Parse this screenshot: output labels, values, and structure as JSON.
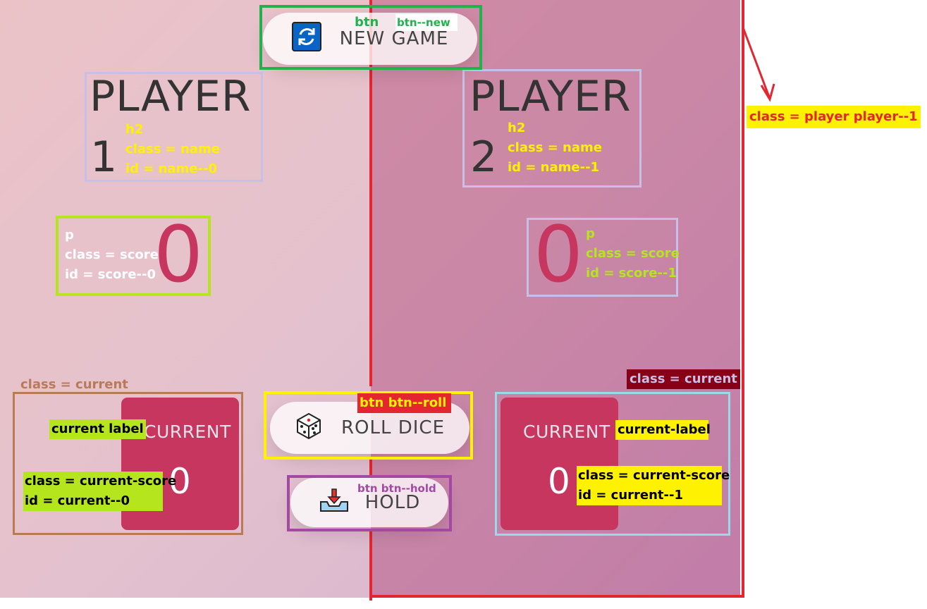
{
  "buttons": {
    "new_game": "NEW GAME",
    "roll_dice": "ROLL DICE",
    "hold": "HOLD"
  },
  "players": [
    {
      "name": "PLAYER",
      "number": "1",
      "score": "0",
      "current_label": "CURRENT",
      "current_score": "0"
    },
    {
      "name": "PLAYER",
      "number": "2",
      "score": "0",
      "current_label": "CURRENT",
      "current_score": "0"
    }
  ],
  "annotations": {
    "btn": "btn",
    "btn_new": "btn--new",
    "btn_roll": "btn   btn--roll",
    "btn_hold": "btn btn--hold",
    "player1_class": "class = player player--1",
    "name0": {
      "tag": "h2",
      "cls": "class = name",
      "id": "id = name--0"
    },
    "name1": {
      "tag": "h2",
      "cls": "class = name",
      "id": "id = name--1"
    },
    "score0": {
      "tag": "p",
      "cls": "class = score",
      "id": "id = score--0"
    },
    "score1": {
      "tag": "p",
      "cls": "class = score",
      "id": "id = score--1"
    },
    "current0_class": "class = current",
    "current1_class": "class = current",
    "current0_label": "current label",
    "current1_label": "current-label",
    "current0_score": {
      "cls": "class = current-score",
      "id": "id = current--0"
    },
    "current1_score": {
      "cls": "class = current-score",
      "id": "id = current--1"
    }
  },
  "colors": {
    "accent": "#c7365f",
    "annotation_red": "#e3262f",
    "annotation_yellow": "#fff200",
    "annotation_green": "#22b14c",
    "annotation_lime": "#b5e61d",
    "annotation_lavender": "#c8bfe7",
    "annotation_purple": "#a349a4",
    "annotation_brown": "#b97a57",
    "annotation_lightblue": "#99d9ea"
  }
}
